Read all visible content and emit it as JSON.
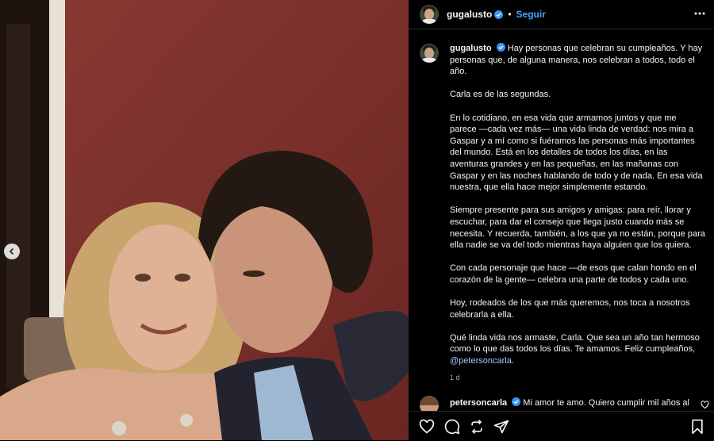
{
  "post": {
    "username": "gugalusto",
    "follow_label": "Seguir",
    "dot": "•",
    "caption": {
      "p1": "Hay personas que celebran su cumpleaños. Y hay personas que, de alguna manera, nos celebran a todos, todo el año.",
      "p2": "Carla es de las segundas.",
      "p3": "En lo cotidiano, en esa vida que armamos juntos y que me parece —cada vez más— una vida linda de verdad: nos mira a Gaspar y a mí como si fuéramos las personas más importantes del mundo. Está en los detalles de todos los días, en las aventuras grandes y en las pequeñas, en las mañanas con Gaspar y en las noches hablando de todo y de nada. En esa vida nuestra, que ella hace mejor simplemente estando.",
      "p4": "Siempre presente para sus amigos y amigas: para reír, llorar y escuchar, para dar el consejo que llega justo cuando más se necesita. Y recuerda, también, a los que ya no están, porque para ella nadie se va del todo mientras haya alguien que los quiera.",
      "p5": "Con cada personaje que hace —de esos que calan hondo en el corazón de la gente— celebra una parte de todos y cada uno.",
      "p6": "Hoy, rodeados de los que más queremos, nos toca a nosotros celebrarla a ella.",
      "p7": "Qué linda vida nos armaste, Carla. Que sea un año tan hermoso como lo que das todos los días. Te amamos. Feliz cumpleaños,",
      "mention": "@petersoncarla",
      "mention_end": "."
    },
    "time": "1 d"
  },
  "comment": {
    "username": "petersoncarla",
    "text": "Mi amor te amo. Quiero cumplir mil años al"
  },
  "icons": {
    "verified": "verified-badge-icon",
    "more": "more-options-icon",
    "like": "heart-icon",
    "comment": "comment-icon",
    "share": "share-icon",
    "repost": "repost-icon",
    "save": "bookmark-icon",
    "prev": "chevron-left-icon"
  },
  "colors": {
    "accent": "#4aa3ff",
    "verified": "#3897f0",
    "background": "#000000",
    "mention": "#a4c8ff"
  }
}
